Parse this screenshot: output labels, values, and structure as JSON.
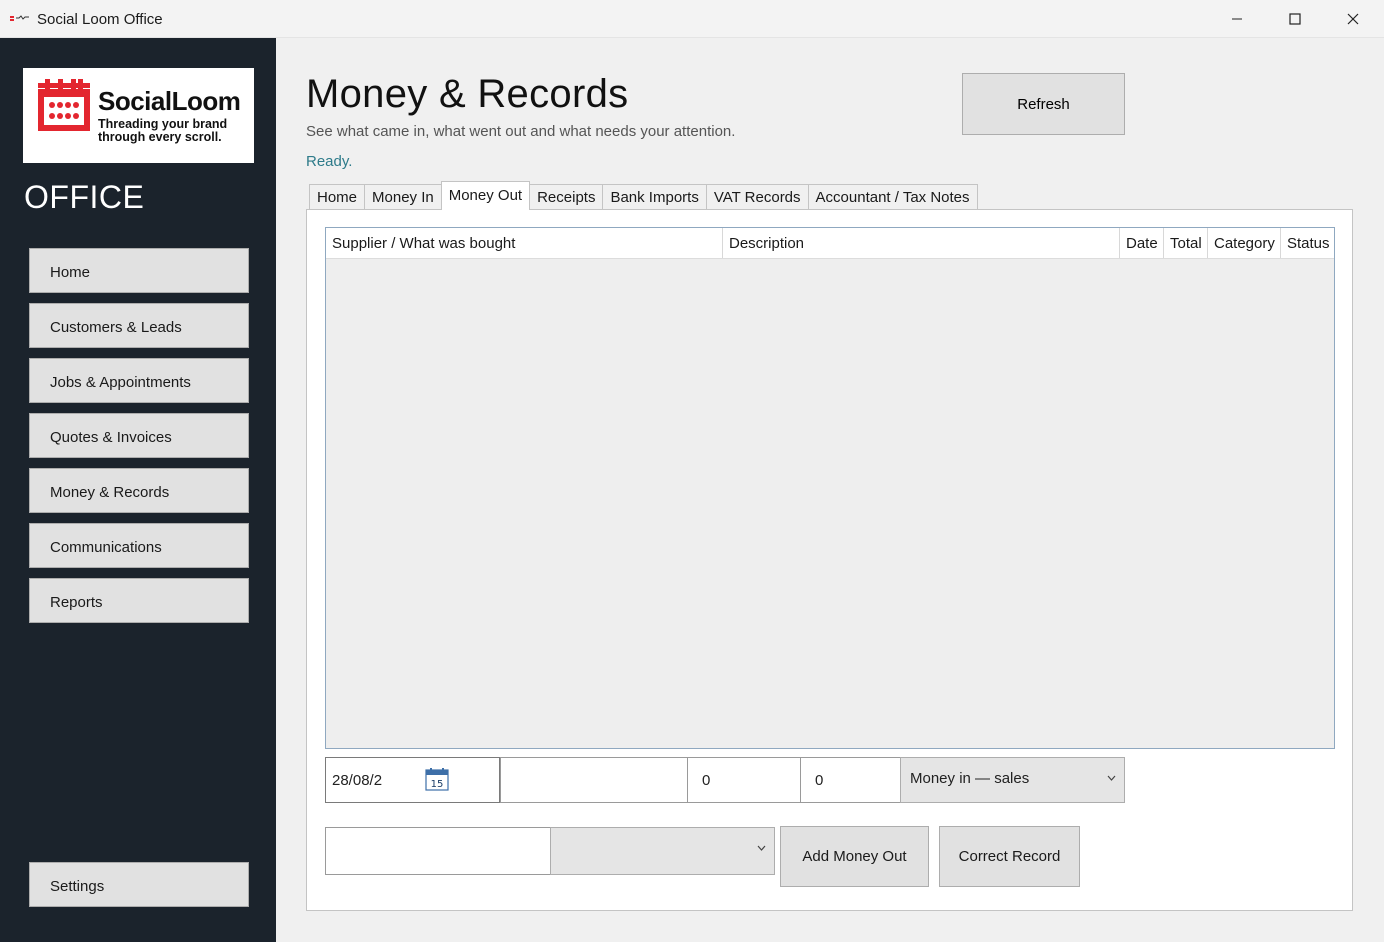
{
  "window": {
    "title": "Social Loom Office"
  },
  "logo": {
    "name": "SocialLoom",
    "tagline": "Threading your brand through every scroll.",
    "brand_color": "#e3262f"
  },
  "sidebar": {
    "office_label": "OFFICE",
    "items": [
      {
        "label": "Home"
      },
      {
        "label": "Customers & Leads"
      },
      {
        "label": "Jobs & Appointments"
      },
      {
        "label": "Quotes & Invoices"
      },
      {
        "label": "Money & Records"
      },
      {
        "label": "Communications"
      },
      {
        "label": "Reports"
      }
    ],
    "settings_label": "Settings",
    "background": "#1b232c"
  },
  "header": {
    "title": "Money & Records",
    "subtitle": "See what came in, what went out and what needs your attention.",
    "status": "Ready.",
    "refresh_label": "Refresh"
  },
  "tabs": [
    {
      "label": "Home"
    },
    {
      "label": "Money In"
    },
    {
      "label": "Money Out",
      "active": true
    },
    {
      "label": "Receipts"
    },
    {
      "label": "Bank Imports"
    },
    {
      "label": "VAT Records"
    },
    {
      "label": "Accountant / Tax Notes"
    }
  ],
  "grid": {
    "columns": [
      "Supplier / What was bought",
      "Description",
      "Date",
      "Total",
      "Category",
      "Status"
    ],
    "rows": []
  },
  "form": {
    "date_value": "28/08/2",
    "date_calendar_day": "15",
    "description_value": "",
    "amount_value": "0",
    "vat_value": "0",
    "category_selected": "Money in — sales",
    "supplier_value": "",
    "status_selected": "",
    "add_label": "Add Money Out",
    "correct_label": "Correct Record"
  }
}
